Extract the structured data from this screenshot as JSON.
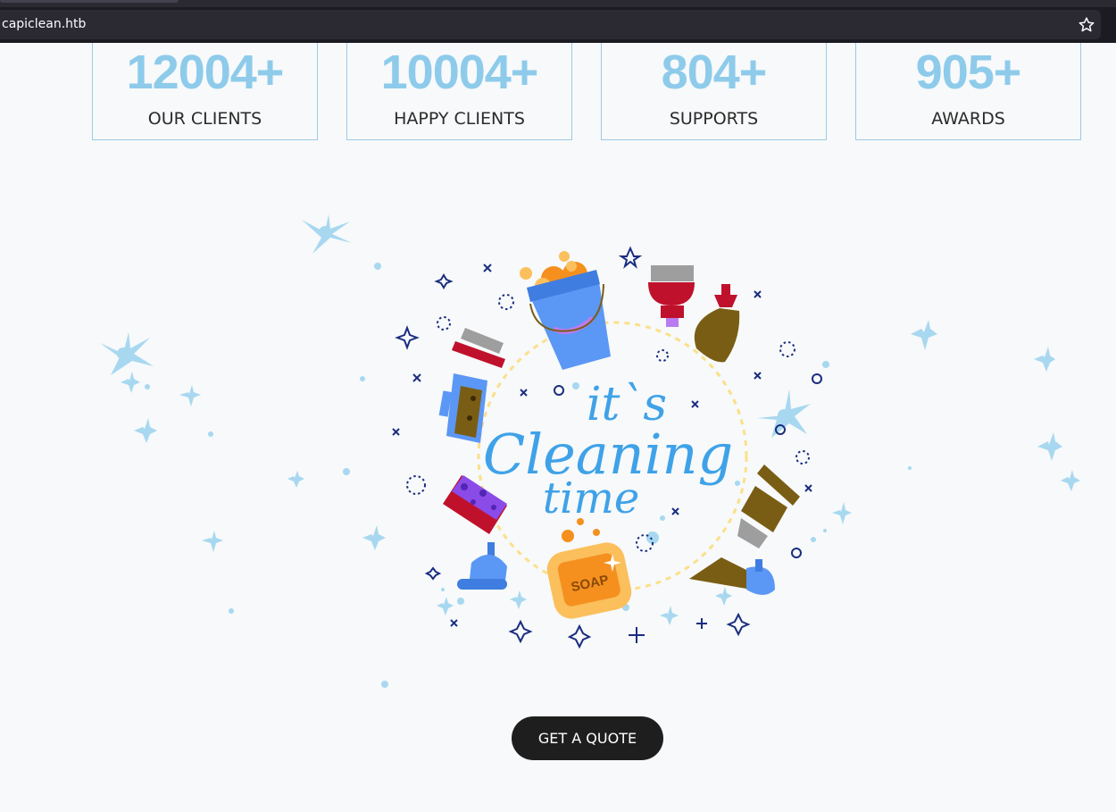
{
  "browser": {
    "url": "capiclean.htb",
    "bookmark_icon": "star-icon"
  },
  "stats": [
    {
      "value": "12004+",
      "label": "OUR CLIENTS"
    },
    {
      "value": "10004+",
      "label": "HAPPY CLIENTS"
    },
    {
      "value": "804+",
      "label": "SUPPORTS"
    },
    {
      "value": "905+",
      "label": "AWARDS"
    }
  ],
  "illustration": {
    "line1": "it`s",
    "line2": "Cleaning",
    "line3": "time",
    "soap_label": "SOAP"
  },
  "cta": {
    "label": "GET A QUOTE"
  },
  "colors": {
    "stat_number": "#8ecbeb",
    "stat_border": "#9ccbe6",
    "button_bg": "#1e1e1e",
    "lettering": "#3fa2e8"
  }
}
